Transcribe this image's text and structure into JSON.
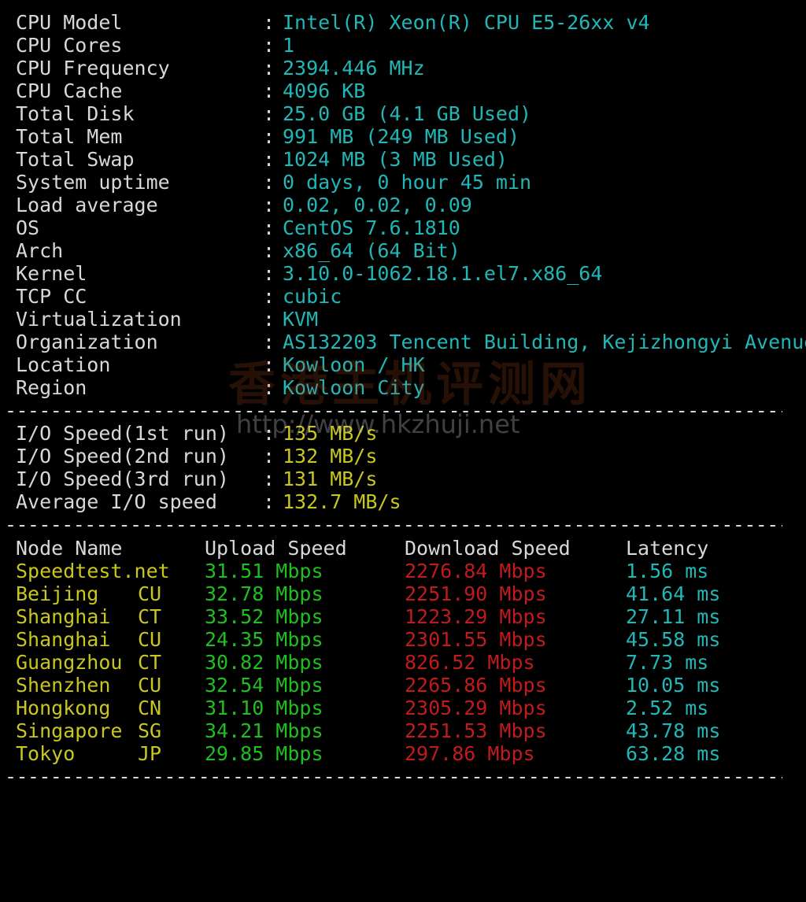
{
  "colors": {
    "background": "#000000",
    "label": "#d8d8d8",
    "sysinfo_value": "#21b7b7",
    "io_value": "#c9c61f",
    "node_name": "#c9c61f",
    "upload": "#1fbf1f",
    "download": "#c11b1b",
    "latency": "#21b7b7",
    "watermark": "#b04a1a"
  },
  "separator": "------------------------------------------------------------------------------------------------------------------",
  "system_info": [
    {
      "label": "CPU Model",
      "colon": ":",
      "value": "Intel(R) Xeon(R) CPU E5-26xx v4"
    },
    {
      "label": "CPU Cores",
      "colon": ":",
      "value": "1"
    },
    {
      "label": "CPU Frequency",
      "colon": ":",
      "value": "2394.446 MHz"
    },
    {
      "label": "CPU Cache",
      "colon": ":",
      "value": "4096 KB"
    },
    {
      "label": "Total Disk",
      "colon": ":",
      "value": "25.0 GB (4.1 GB Used)"
    },
    {
      "label": "Total Mem",
      "colon": ":",
      "value": "991 MB (249 MB Used)"
    },
    {
      "label": "Total Swap",
      "colon": ":",
      "value": "1024 MB (3 MB Used)"
    },
    {
      "label": "System uptime",
      "colon": ":",
      "value": "0 days, 0 hour 45 min"
    },
    {
      "label": "Load average",
      "colon": ":",
      "value": "0.02, 0.02, 0.09"
    },
    {
      "label": "OS",
      "colon": ":",
      "value": "CentOS 7.6.1810"
    },
    {
      "label": "Arch",
      "colon": ":",
      "value": "x86_64 (64 Bit)"
    },
    {
      "label": "Kernel",
      "colon": ":",
      "value": "3.10.0-1062.18.1.el7.x86_64"
    },
    {
      "label": "TCP CC",
      "colon": ":",
      "value": "cubic"
    },
    {
      "label": "Virtualization",
      "colon": ":",
      "value": "KVM"
    },
    {
      "label": "Organization",
      "colon": ":",
      "value": "AS132203 Tencent Building, Kejizhongyi Avenue"
    },
    {
      "label": "Location",
      "colon": ":",
      "value": "Kowloon / HK"
    },
    {
      "label": "Region",
      "colon": ":",
      "value": "Kowloon City"
    }
  ],
  "io_speed": [
    {
      "label": "I/O Speed(1st run)",
      "colon": ":",
      "value": "135 MB/s"
    },
    {
      "label": "I/O Speed(2nd run)",
      "colon": ":",
      "value": "132 MB/s"
    },
    {
      "label": "I/O Speed(3rd run)",
      "colon": ":",
      "value": "131 MB/s"
    },
    {
      "label": "Average I/O speed",
      "colon": ":",
      "value": "132.7 MB/s"
    }
  ],
  "speedtest": {
    "headers": {
      "node": "Node Name",
      "upload": "Upload Speed",
      "download": "Download Speed",
      "latency": "Latency"
    },
    "rows": [
      {
        "node": "Speedtest.net",
        "isp": "",
        "upload": "31.51 Mbps",
        "download": "2276.84 Mbps",
        "latency": "1.56 ms"
      },
      {
        "node": "Beijing",
        "isp": "CU",
        "upload": "32.78 Mbps",
        "download": "2251.90 Mbps",
        "latency": "41.64 ms"
      },
      {
        "node": "Shanghai",
        "isp": "CT",
        "upload": "33.52 Mbps",
        "download": "1223.29 Mbps",
        "latency": "27.11 ms"
      },
      {
        "node": "Shanghai",
        "isp": "CU",
        "upload": "24.35 Mbps",
        "download": "2301.55 Mbps",
        "latency": "45.58 ms"
      },
      {
        "node": "Guangzhou",
        "isp": "CT",
        "upload": "30.82 Mbps",
        "download": "826.52 Mbps",
        "latency": "7.73 ms"
      },
      {
        "node": "Shenzhen",
        "isp": "CU",
        "upload": "32.54 Mbps",
        "download": "2265.86 Mbps",
        "latency": "10.05 ms"
      },
      {
        "node": "Hongkong",
        "isp": "CN",
        "upload": "31.10 Mbps",
        "download": "2305.29 Mbps",
        "latency": "2.52 ms"
      },
      {
        "node": "Singapore",
        "isp": "SG",
        "upload": "34.21 Mbps",
        "download": "2251.53 Mbps",
        "latency": "43.78 ms"
      },
      {
        "node": "Tokyo",
        "isp": "JP",
        "upload": "29.85 Mbps",
        "download": "297.86 Mbps",
        "latency": "63.28 ms"
      }
    ]
  },
  "watermark": {
    "title": "香港主机评测网",
    "url": "http://www.hkzhuji.net"
  }
}
